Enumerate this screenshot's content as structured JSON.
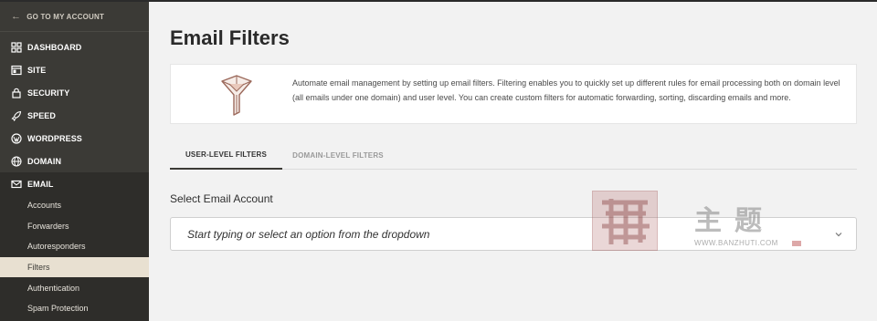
{
  "sidebar": {
    "back_label": "GO TO MY ACCOUNT",
    "items": [
      {
        "label": "DASHBOARD",
        "icon": "dashboard-icon"
      },
      {
        "label": "SITE",
        "icon": "site-icon"
      },
      {
        "label": "SECURITY",
        "icon": "lock-icon"
      },
      {
        "label": "SPEED",
        "icon": "rocket-icon"
      },
      {
        "label": "WORDPRESS",
        "icon": "wordpress-icon"
      },
      {
        "label": "DOMAIN",
        "icon": "globe-icon"
      }
    ],
    "email": {
      "label": "EMAIL",
      "icon": "mail-icon",
      "subitems": [
        {
          "label": "Accounts"
        },
        {
          "label": "Forwarders"
        },
        {
          "label": "Autoresponders"
        },
        {
          "label": "Filters",
          "active": true
        },
        {
          "label": "Authentication"
        },
        {
          "label": "Spam Protection"
        }
      ]
    }
  },
  "main": {
    "title": "Email Filters",
    "description": "Automate email management by setting up email filters. Filtering enables you to quickly set up different rules for email processing both on domain level (all emails under one domain) and user level. You can create custom filters for automatic forwarding, sorting, discarding emails and more.",
    "tabs": [
      {
        "label": "USER-LEVEL FILTERS",
        "active": true
      },
      {
        "label": "DOMAIN-LEVEL FILTERS",
        "active": false
      }
    ],
    "select_label": "Select Email Account",
    "dropdown_placeholder": "Start typing or select an option from the dropdown"
  },
  "watermark": {
    "text": "主题",
    "url": "WWW.BANZHUTI.COM"
  },
  "colors": {
    "sidebar_bg": "#3b3a36",
    "email_group_bg": "#2e2d2a",
    "active_subitem_bg": "#e8e0d1",
    "page_bg": "#f2f2f2",
    "accent_art": "#b07b6a"
  }
}
